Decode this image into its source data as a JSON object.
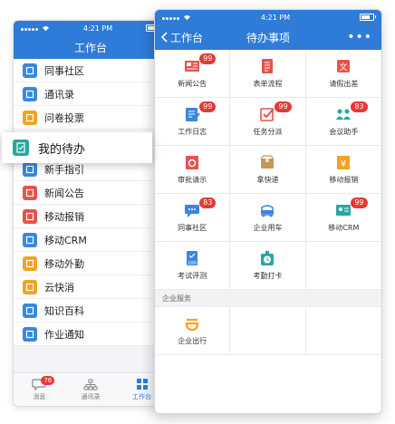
{
  "back": {
    "status_time": "4:21 PM",
    "title": "工作台",
    "items": [
      {
        "label": "同事社区",
        "icon": "community-icon",
        "color": "#3a86e0"
      },
      {
        "label": "通讯录",
        "icon": "contacts-icon",
        "color": "#3a86e0"
      },
      {
        "label": "问卷投票",
        "icon": "survey-icon",
        "color": "#f2a321"
      },
      {
        "label": "新手指引",
        "icon": "guide-icon",
        "color": "#3a86e0"
      },
      {
        "label": "新闻公告",
        "icon": "news-icon",
        "color": "#e5534b"
      },
      {
        "label": "移动报销",
        "icon": "expense-icon",
        "color": "#e5534b"
      },
      {
        "label": "移动CRM",
        "icon": "crm-icon",
        "color": "#3a86e0"
      },
      {
        "label": "移动外勤",
        "icon": "field-icon",
        "color": "#f2a321"
      },
      {
        "label": "云快消",
        "icon": "fmcg-icon",
        "color": "#f2a321"
      },
      {
        "label": "知识百科",
        "icon": "wiki-icon",
        "color": "#3a86e0"
      },
      {
        "label": "作业通知",
        "icon": "notice-icon",
        "color": "#3a86e0"
      }
    ],
    "highlight": "我的待办",
    "tabs": [
      {
        "label": "消息",
        "badge": "76"
      },
      {
        "label": "通讯录"
      },
      {
        "label": "工作台"
      }
    ]
  },
  "front": {
    "status_time": "4:21 PM",
    "back_label": "工作台",
    "title": "待办事项",
    "more": "•••",
    "grid": [
      {
        "label": "新闻公告",
        "badge": "99",
        "icon": "news-icon",
        "color": "#e5534b"
      },
      {
        "label": "表单流程",
        "badge": "",
        "icon": "form-flow-icon",
        "color": "#e5534b"
      },
      {
        "label": "请假出差",
        "badge": "",
        "icon": "leave-icon",
        "color": "#e5534b"
      },
      {
        "label": "工作日志",
        "badge": "99",
        "icon": "worklog-icon",
        "color": "#3a86e0"
      },
      {
        "label": "任务分派",
        "badge": "99",
        "icon": "task-icon",
        "color": "#e5534b"
      },
      {
        "label": "会议助手",
        "badge": "83",
        "icon": "meeting-icon",
        "color": "#27a7a0"
      },
      {
        "label": "审批请示",
        "badge": "",
        "icon": "approval-icon",
        "color": "#e5534b"
      },
      {
        "label": "拿快递",
        "badge": "",
        "icon": "express-icon",
        "color": "#c8955a"
      },
      {
        "label": "移动报销",
        "badge": "",
        "icon": "expense-icon",
        "color": "#f2a321"
      },
      {
        "label": "同事社区",
        "badge": "83",
        "icon": "community-icon",
        "color": "#3a86e0"
      },
      {
        "label": "企业用车",
        "badge": "",
        "icon": "car-icon",
        "color": "#3a86e0"
      },
      {
        "label": "移动CRM",
        "badge": "99",
        "icon": "crm-icon",
        "color": "#27a7a0"
      },
      {
        "label": "考试评测",
        "badge": "",
        "icon": "exam-icon",
        "color": "#3a86e0"
      },
      {
        "label": "考勤打卡",
        "badge": "",
        "icon": "clock-in-icon",
        "color": "#27a7a0"
      }
    ],
    "section_title": "企业服务",
    "services": [
      {
        "label": "企业出行",
        "icon": "didi-icon",
        "color": "#f2a321"
      }
    ]
  }
}
